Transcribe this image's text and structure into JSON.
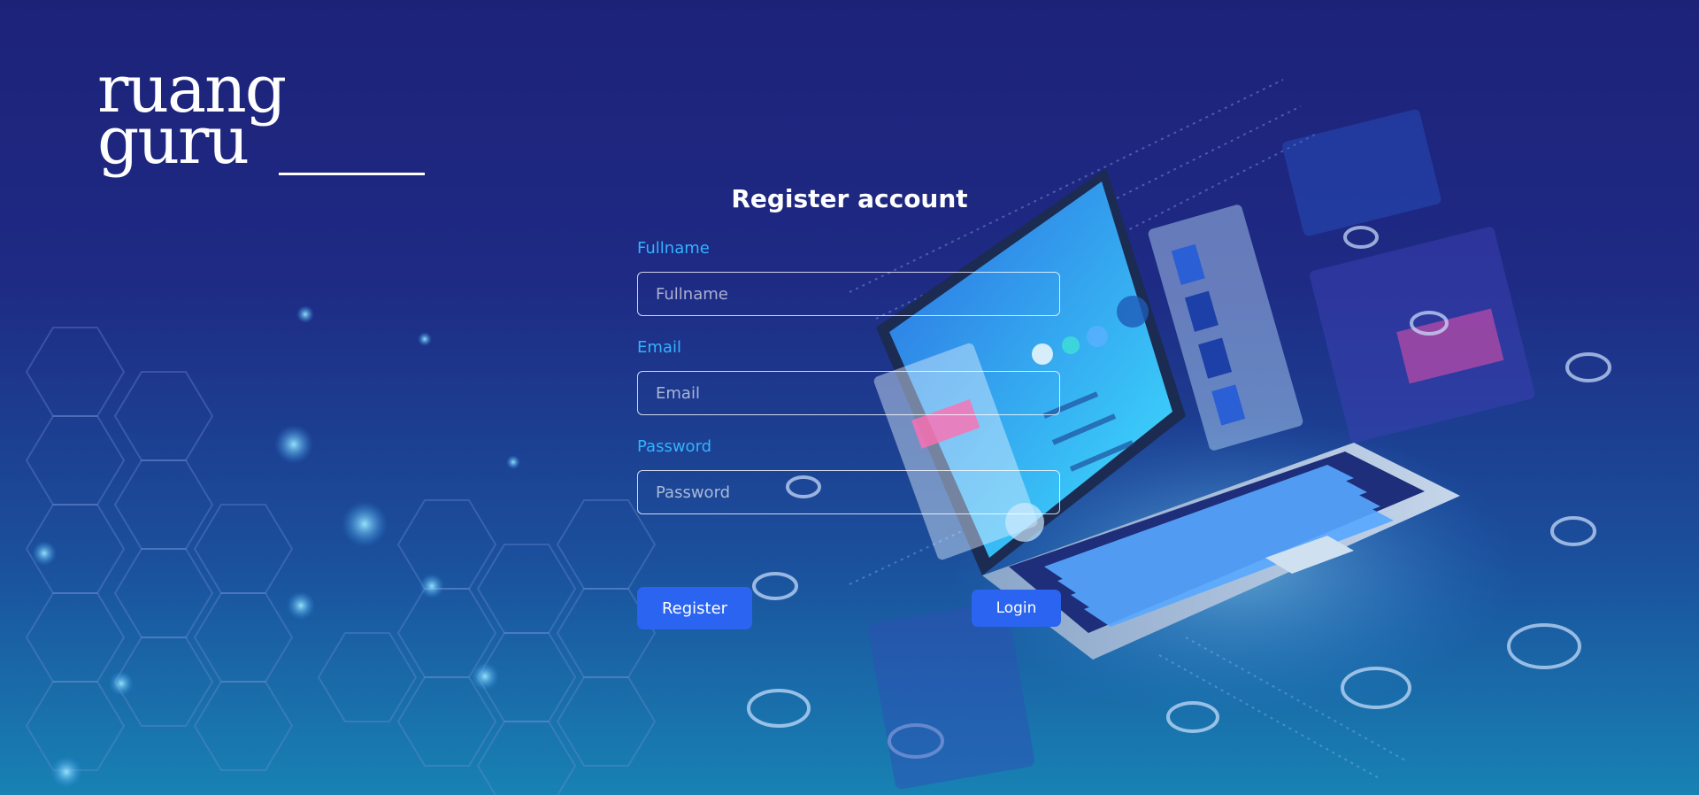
{
  "brand": {
    "line1": "ruang",
    "line2": "guru"
  },
  "form": {
    "title": "Register account",
    "fullname": {
      "label": "Fullname",
      "placeholder": "Fullname",
      "value": ""
    },
    "email": {
      "label": "Email",
      "placeholder": "Email",
      "value": ""
    },
    "password": {
      "label": "Password",
      "placeholder": "Password",
      "value": ""
    },
    "register_label": "Register",
    "login_label": "Login"
  },
  "colors": {
    "accent": "#2a64f0",
    "label": "#33b2ff",
    "background_top": "#1d2279",
    "background_bottom": "#1882b3"
  }
}
